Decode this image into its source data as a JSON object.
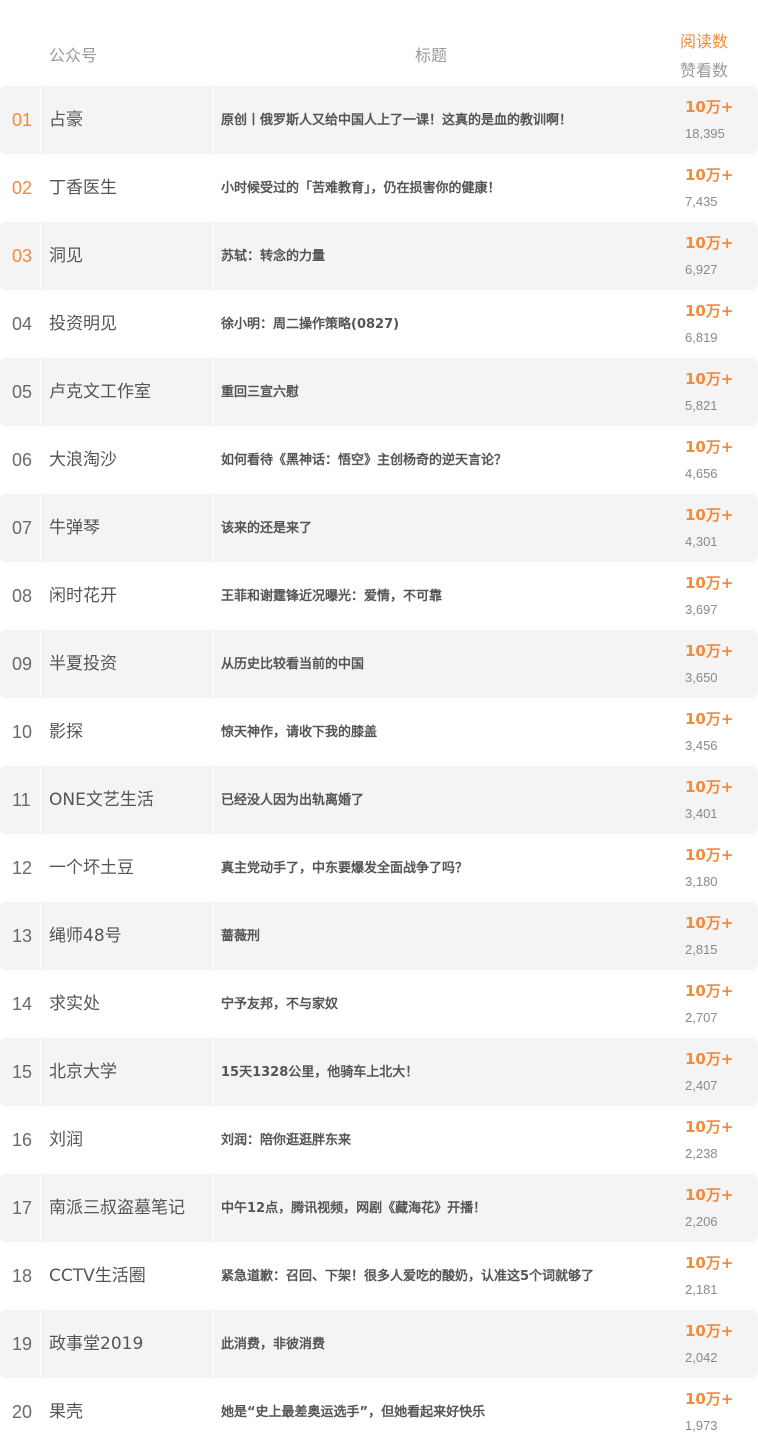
{
  "header": {
    "account_label": "公众号",
    "title_label": "标题",
    "reads_label": "阅读数",
    "likes_label": "赞看数"
  },
  "rows": [
    {
      "rank": "01",
      "account": "占豪",
      "title": "原创丨俄罗斯人又给中国人上了一课！这真的是血的教训啊！",
      "reads": "10万+",
      "likes": "18,395"
    },
    {
      "rank": "02",
      "account": "丁香医生",
      "title": "小时候受过的「苦难教育」，仍在损害你的健康！",
      "reads": "10万+",
      "likes": "7,435"
    },
    {
      "rank": "03",
      "account": "洞见",
      "title": "苏轼：转念的力量",
      "reads": "10万+",
      "likes": "6,927"
    },
    {
      "rank": "04",
      "account": "投资明见",
      "title": "徐小明：周二操作策略(0827)",
      "reads": "10万+",
      "likes": "6,819"
    },
    {
      "rank": "05",
      "account": "卢克文工作室",
      "title": "重回三宣六慰",
      "reads": "10万+",
      "likes": "5,821"
    },
    {
      "rank": "06",
      "account": "大浪淘沙",
      "title": "如何看待《黑神话：悟空》主创杨奇的逆天言论？",
      "reads": "10万+",
      "likes": "4,656"
    },
    {
      "rank": "07",
      "account": "牛弹琴",
      "title": "该来的还是来了",
      "reads": "10万+",
      "likes": "4,301"
    },
    {
      "rank": "08",
      "account": "闲时花开",
      "title": "王菲和谢霆锋近况曝光：爱情，不可靠",
      "reads": "10万+",
      "likes": "3,697"
    },
    {
      "rank": "09",
      "account": "半夏投资",
      "title": "从历史比较看当前的中国",
      "reads": "10万+",
      "likes": "3,650"
    },
    {
      "rank": "10",
      "account": "影探",
      "title": "惊天神作，请收下我的膝盖",
      "reads": "10万+",
      "likes": "3,456"
    },
    {
      "rank": "11",
      "account": "ONE文艺生活",
      "title": "已经没人因为出轨离婚了",
      "reads": "10万+",
      "likes": "3,401"
    },
    {
      "rank": "12",
      "account": "一个坏土豆",
      "title": "真主党动手了，中东要爆发全面战争了吗？",
      "reads": "10万+",
      "likes": "3,180"
    },
    {
      "rank": "13",
      "account": "绳师48号",
      "title": "蔷薇刑",
      "reads": "10万+",
      "likes": "2,815"
    },
    {
      "rank": "14",
      "account": "求实处",
      "title": "宁予友邦，不与家奴",
      "reads": "10万+",
      "likes": "2,707"
    },
    {
      "rank": "15",
      "account": "北京大学",
      "title": "15天1328公里，他骑车上北大！",
      "reads": "10万+",
      "likes": "2,407"
    },
    {
      "rank": "16",
      "account": "刘润",
      "title": "刘润：陪你逛逛胖东来",
      "reads": "10万+",
      "likes": "2,238"
    },
    {
      "rank": "17",
      "account": "南派三叔盗墓笔记",
      "title": "中午12点，腾讯视频，网剧《藏海花》开播！",
      "reads": "10万+",
      "likes": "2,206"
    },
    {
      "rank": "18",
      "account": "CCTV生活圈",
      "title": "紧急道歉：召回、下架！很多人爱吃的酸奶，认准这5个词就够了",
      "reads": "10万+",
      "likes": "2,181"
    },
    {
      "rank": "19",
      "account": "政事堂2019",
      "title": "此消费，非彼消费",
      "reads": "10万+",
      "likes": "2,042"
    },
    {
      "rank": "20",
      "account": "果壳",
      "title": "她是“史上最差奥运选手”，但她看起来好快乐",
      "reads": "10万+",
      "likes": "1,973"
    }
  ]
}
